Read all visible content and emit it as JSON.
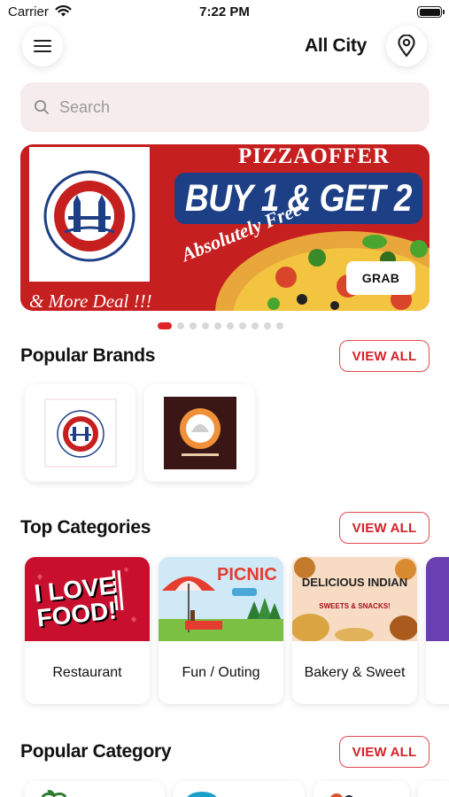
{
  "status_bar": {
    "carrier": "Carrier",
    "time": "7:22 PM"
  },
  "header": {
    "city_title": "All City",
    "menu_icon": "hamburger-icon",
    "location_icon": "map-pin-icon"
  },
  "search": {
    "placeholder": "Search"
  },
  "banner": {
    "brand_arc_text": "LONDON YARD PIZZA",
    "offer_label": "PIZZAOFFER",
    "headline": "BUY 1 & GET 2",
    "tagline": "Absolutely Free",
    "deal_text": "& More Deal !!!",
    "grab_label": "GRAB",
    "slides_total": 10,
    "active_slide": 1
  },
  "popular_brands": {
    "title": "Popular Brands",
    "view_all_label": "VIEW ALL",
    "items": [
      {
        "name": "London Yard Pizza"
      },
      {
        "name": "Bistro & Cafe"
      }
    ]
  },
  "top_categories": {
    "title": "Top Categories",
    "view_all_label": "VIEW ALL",
    "items": [
      {
        "label": "Restaurant",
        "image_text": "I LOVE FOOD!"
      },
      {
        "label": "Fun / Outing",
        "image_text": "PICNIC"
      },
      {
        "label": "Bakery & Sweet",
        "image_text": "DELICIOUS INDIAN",
        "image_subtext": "SWEETS & SNACKS!"
      }
    ]
  },
  "popular_category": {
    "title": "Popular Category",
    "view_all_label": "VIEW ALL"
  },
  "colors": {
    "accent": "#e0242b",
    "banner_red": "#c61f1f",
    "banner_blue": "#1d3f86",
    "search_bg": "#f7eced"
  }
}
